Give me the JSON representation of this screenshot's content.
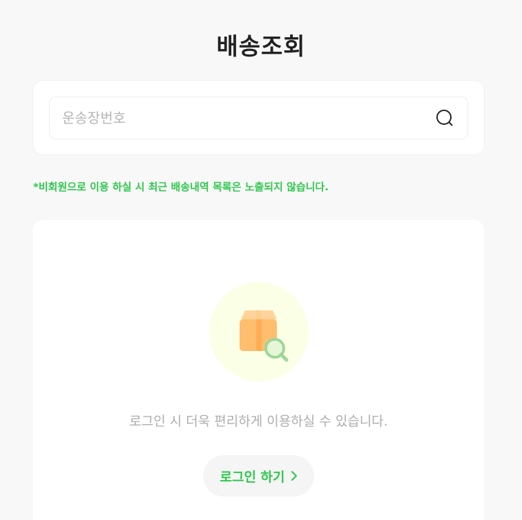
{
  "header": {
    "title": "배송조회"
  },
  "search": {
    "placeholder": "운송장번호",
    "value": ""
  },
  "notice": {
    "text": "*비회원으로 이용 하실 시 최근 배송내역 목록은 노출되지 않습니다."
  },
  "login_prompt": {
    "message": "로그인 시 더욱 편리하게 이용하실 수 있습니다.",
    "button_label": "로그인 하기"
  },
  "icons": {
    "search": "search-icon",
    "illustration": "box-search-illustration",
    "chevron": "chevron-right-icon"
  },
  "colors": {
    "accent": "#2fc84d",
    "illustration_bg": "#fbffe6",
    "box": "#ffbd6e"
  }
}
